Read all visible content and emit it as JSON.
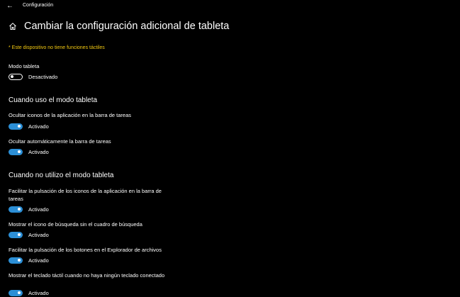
{
  "window": {
    "back_glyph": "←",
    "app_title": "Configuración"
  },
  "header": {
    "icon": "home-icon",
    "title": "Cambiar la configuración adicional de tableta"
  },
  "warning": "* Este dispositivo no tiene funciones táctiles",
  "tablet_mode": {
    "label": "Modo tableta",
    "state": "Desactivado",
    "on": false
  },
  "section_using": {
    "title": "Cuando uso el modo tableta",
    "settings": [
      {
        "label": "Ocultar iconos de la aplicación en la barra de tareas",
        "state": "Activado",
        "on": true
      },
      {
        "label": "Ocultar automáticamente la barra de tareas",
        "state": "Activado",
        "on": true
      }
    ]
  },
  "section_not_using": {
    "title": "Cuando no utilizo el modo tableta",
    "settings": [
      {
        "label": "Facilitar la pulsación de los iconos de la aplicación en la barra de tareas",
        "state": "Activado",
        "on": true
      },
      {
        "label": "Mostrar el icono de búsqueda sin el cuadro de búsqueda",
        "state": "Activado",
        "on": true
      },
      {
        "label": "Facilitar la pulsación de los botones en el Explorador de archivos",
        "state": "Activado",
        "on": true
      },
      {
        "label": "Mostrar el teclado táctil cuando no haya ningún teclado conectado",
        "state": "Activado",
        "on": true
      }
    ]
  },
  "colors": {
    "background": "#000000",
    "accent": "#2c8fd6",
    "warning": "#f2c811"
  }
}
